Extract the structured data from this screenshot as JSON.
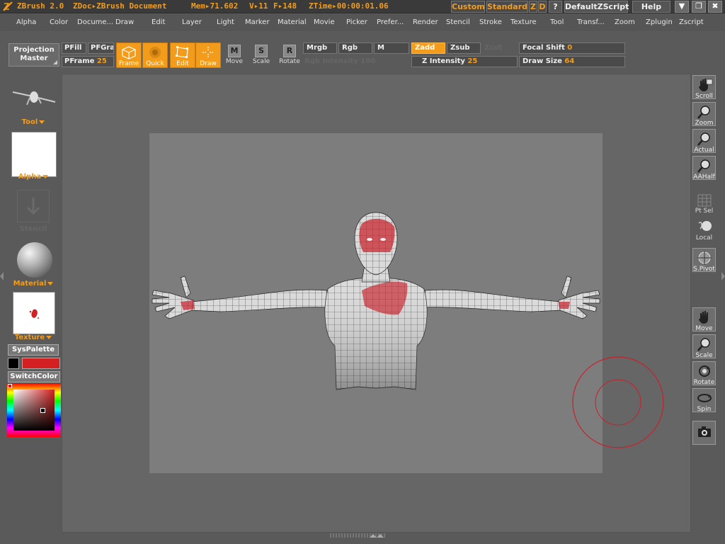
{
  "titlebar": {
    "app_title": "ZBrush 2.0",
    "doc_title": "ZDoc▸ZBrush Document",
    "mem": "Mem▸71.602",
    "verts": "V▸11",
    "faces": "F▸148",
    "ztime": "ZTime▸00:00:01.06",
    "custom_label": "Custom",
    "standard_label": "Standard",
    "z_label": "Z",
    "d_label": "D",
    "question_label": "?",
    "script_label": "DefaultZScript",
    "help_label": "Help",
    "minimize_glyph": "▼",
    "restore_glyph": "❐",
    "close_glyph": "✖"
  },
  "menu": [
    "Alpha",
    "Color",
    "Docume...",
    "Draw",
    "Edit",
    "Layer",
    "Light",
    "Marker",
    "Material",
    "Movie",
    "Picker",
    "Prefer...",
    "Render",
    "Stencil",
    "Stroke",
    "Texture",
    "Tool",
    "Transf...",
    "Zoom",
    "Zplugin",
    "Zscript"
  ],
  "toolbar": {
    "projection_master": [
      "Projection",
      "Master"
    ],
    "pfill": "PFill",
    "pfgra": "PFGra",
    "pframe_label": "PFrame",
    "pframe_value": "25",
    "frame_label": "Frame",
    "quick_label": "Quick",
    "edit_label": "Edit",
    "draw_label": "Draw",
    "move_label": "Move",
    "move_glyph": "M",
    "scale_label": "Scale",
    "scale_glyph": "S",
    "rotate_label": "Rotate",
    "rotate_glyph": "R",
    "mrgb": "Mrgb",
    "rgb": "Rgb",
    "m": "M",
    "rgb_intensity": "Rgb Intensity 100",
    "zadd": "Zadd",
    "zsub": "Zsub",
    "zcut": "Zcut",
    "z_intensity_label": "Z Intensity",
    "z_intensity_value": "25",
    "focal_shift_label": "Focal Shift",
    "focal_shift_value": "0",
    "draw_size_label": "Draw Size",
    "draw_size_value": "64"
  },
  "left": {
    "tool_label": "Tool",
    "alpha_label": "Alpha",
    "stencil_label": "Stencil",
    "material_label": "Material",
    "texture_label": "Texture",
    "syspalette_label": "SysPalette",
    "switchcolor_label": "SwitchColor",
    "main_color": "#000000",
    "secondary_color": "#d42020"
  },
  "right": [
    {
      "label": "Scroll",
      "icon": "hand-icon"
    },
    {
      "label": "Zoom",
      "icon": "magnifier-icon"
    },
    {
      "label": "Actual",
      "icon": "magnifier-icon"
    },
    {
      "label": "AAHalf",
      "icon": "magnifier-icon"
    },
    {
      "label": "Pt Sel",
      "icon": "grid-icon"
    },
    {
      "label": "Local",
      "icon": "sphere-icon"
    },
    {
      "label": "S.Pivot",
      "icon": "pivot-icon"
    },
    {
      "label": "Move",
      "icon": "hand-icon"
    },
    {
      "label": "Scale",
      "icon": "magnifier-icon"
    },
    {
      "label": "Rotate",
      "icon": "rotate-icon"
    },
    {
      "label": "Spin",
      "icon": "spin-icon"
    },
    {
      "label": "",
      "icon": "camera-icon"
    }
  ],
  "colors": {
    "accent": "#f39c1c",
    "paint": "#c8202a",
    "brush_ring": "#c8202a"
  }
}
